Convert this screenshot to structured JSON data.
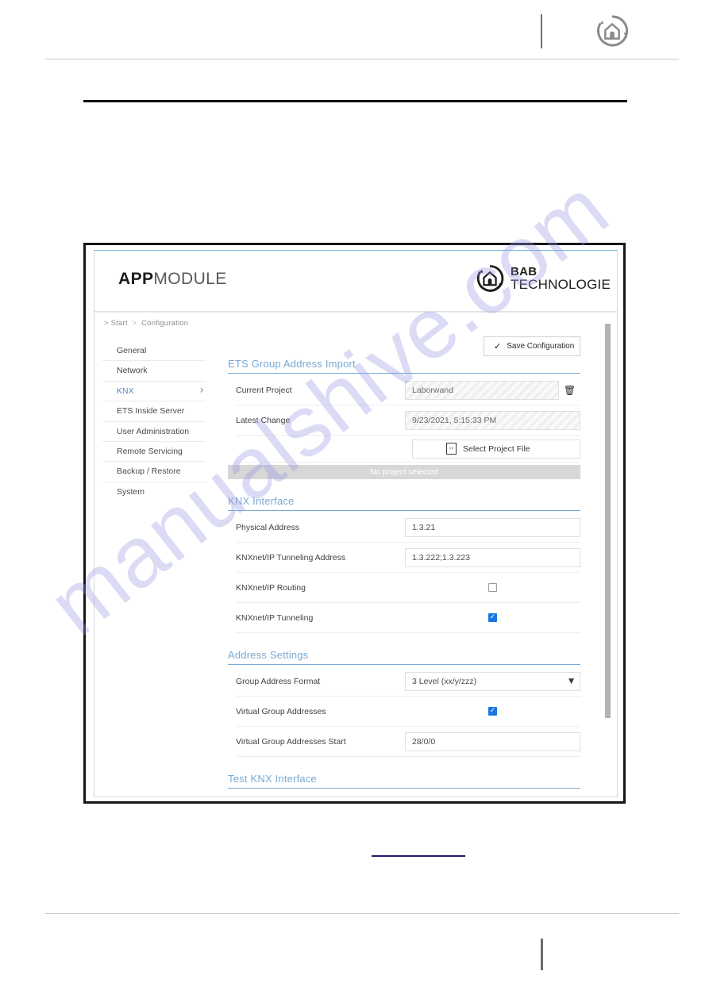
{
  "page": {
    "watermark": "manualshive.com"
  },
  "app": {
    "brand_bold": "APP",
    "brand_light": "MODULE",
    "logo": {
      "line1": "BAB",
      "line2": "TECHNOLOGIE"
    }
  },
  "breadcrumb": {
    "prefix": ">",
    "items": [
      "Start",
      "Configuration"
    ],
    "separator": ">"
  },
  "sidebar": {
    "items": [
      {
        "label": "General",
        "active": false,
        "chevron": false
      },
      {
        "label": "Network",
        "active": false,
        "chevron": false
      },
      {
        "label": "KNX",
        "active": true,
        "chevron": true
      },
      {
        "label": "ETS Inside Server",
        "active": false,
        "chevron": false
      },
      {
        "label": "User Administration",
        "active": false,
        "chevron": false
      },
      {
        "label": "Remote Servicing",
        "active": false,
        "chevron": false
      },
      {
        "label": "Backup / Restore",
        "active": false,
        "chevron": false
      },
      {
        "label": "System",
        "active": false,
        "chevron": false
      }
    ]
  },
  "toolbar": {
    "save_label": "Save Configuration",
    "save_icon": "check-icon"
  },
  "sections": {
    "import": {
      "title": "ETS Group Address Import",
      "rows": [
        {
          "label": "Current Project",
          "value": "Laborwand"
        },
        {
          "label": "Latest Change",
          "value": "9/23/2021, 5:15:33 PM"
        }
      ],
      "delete_icon": "trash-icon",
      "select_file_label": "Select Project File",
      "select_file_icon": "file-code-icon",
      "status": "No project selected"
    },
    "knx_interface": {
      "title": "KNX Interface",
      "rows": [
        {
          "label": "Physical Address",
          "value": "1.3.21"
        },
        {
          "label": "KNXnet/IP Tunneling Address",
          "value": "1.3.222;1.3.223"
        },
        {
          "label": "KNXnet/IP Routing",
          "checked": false
        },
        {
          "label": "KNXnet/IP Tunneling",
          "checked": true
        }
      ]
    },
    "address_settings": {
      "title": "Address Settings",
      "rows": [
        {
          "label": "Group Address Format",
          "value": "3 Level (xx/y/zzz)"
        },
        {
          "label": "Virtual Group Addresses",
          "checked": true
        },
        {
          "label": "Virtual Group Addresses Start",
          "value": "28/0/0"
        }
      ],
      "format_options": [
        "3 Level (xx/y/zzz)"
      ]
    },
    "test": {
      "title": "Test KNX Interface"
    }
  },
  "colors": {
    "accent": "#7aa9d4",
    "checkbox_checked": "#1878e0",
    "status_bar": "#d7d7d7",
    "link_rule": "#1c1c6e"
  }
}
